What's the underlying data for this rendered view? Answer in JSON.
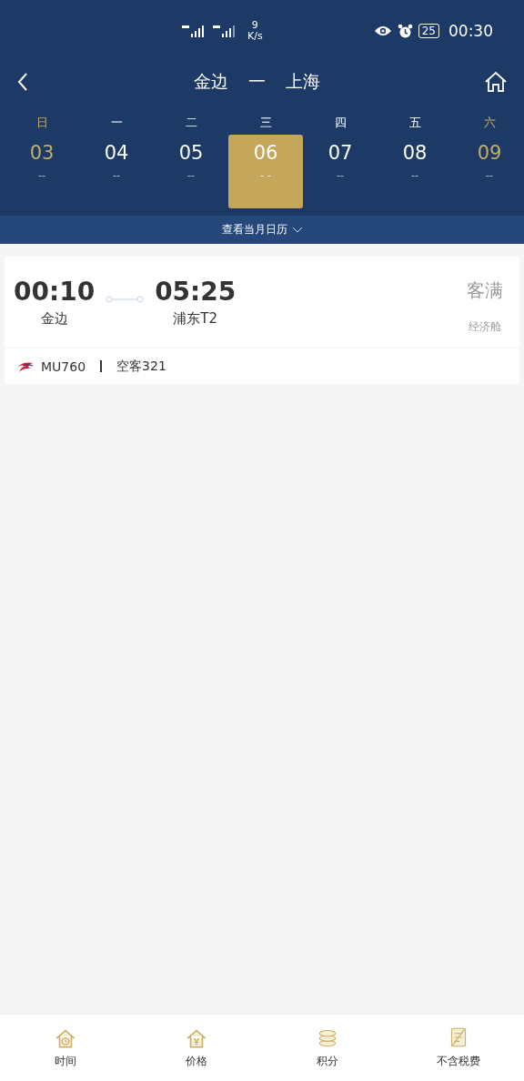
{
  "status_bar": {
    "speed": "9",
    "speed_unit": "K/s",
    "battery": "25",
    "time": "00:30"
  },
  "header": {
    "from": "金边",
    "separator": "一",
    "to": "上海"
  },
  "days": [
    {
      "weekday": "日",
      "date": "03",
      "price": "--",
      "weekend": true,
      "selected": false
    },
    {
      "weekday": "一",
      "date": "04",
      "price": "--",
      "weekend": false,
      "selected": false
    },
    {
      "weekday": "二",
      "date": "05",
      "price": "--",
      "weekend": false,
      "selected": false
    },
    {
      "weekday": "三",
      "date": "06",
      "price": "- -",
      "weekend": false,
      "selected": true
    },
    {
      "weekday": "四",
      "date": "07",
      "price": "--",
      "weekend": false,
      "selected": false
    },
    {
      "weekday": "五",
      "date": "08",
      "price": "--",
      "weekend": false,
      "selected": false
    },
    {
      "weekday": "六",
      "date": "09",
      "price": "--",
      "weekend": true,
      "selected": false
    }
  ],
  "calendar_toggle": "查看当月日历",
  "flights": [
    {
      "depart_time": "00:10",
      "depart_airport": "金边",
      "arrive_time": "05:25",
      "arrive_airport": "浦东T2",
      "status": "客满",
      "cabin": "经济舱",
      "flight_no": "MU760",
      "aircraft": "空客321"
    }
  ],
  "bottom_tabs": [
    {
      "label": "时间",
      "kind": "clock"
    },
    {
      "label": "价格",
      "kind": "yen"
    },
    {
      "label": "积分",
      "kind": "coins"
    },
    {
      "label": "不含税费",
      "kind": "tax"
    }
  ]
}
